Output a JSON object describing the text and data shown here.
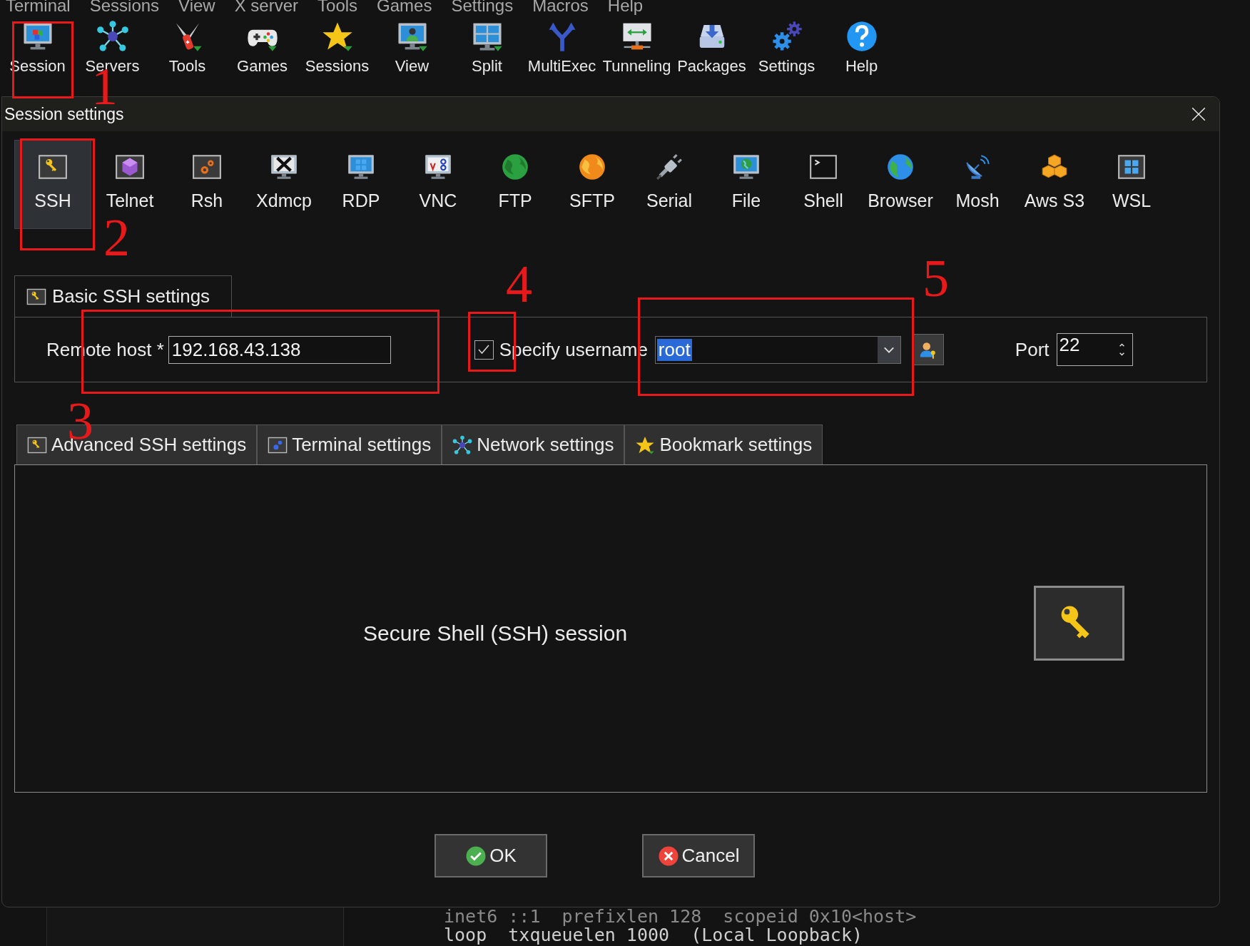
{
  "menu": [
    "Terminal",
    "Sessions",
    "View",
    "X server",
    "Tools",
    "Games",
    "Settings",
    "Macros",
    "Help"
  ],
  "toolbar": [
    {
      "label": "Session",
      "callout": "1"
    },
    {
      "label": "Servers"
    },
    {
      "label": "Tools"
    },
    {
      "label": "Games"
    },
    {
      "label": "Sessions"
    },
    {
      "label": "View"
    },
    {
      "label": "Split"
    },
    {
      "label": "MultiExec"
    },
    {
      "label": "Tunneling"
    },
    {
      "label": "Packages"
    },
    {
      "label": "Settings"
    },
    {
      "label": "Help"
    }
  ],
  "dialog": {
    "title": "Session settings",
    "session_types": [
      {
        "label": "SSH",
        "selected": true,
        "callout": "2"
      },
      {
        "label": "Telnet",
        "selected": false
      },
      {
        "label": "Rsh",
        "selected": false
      },
      {
        "label": "Xdmcp",
        "selected": false
      },
      {
        "label": "RDP",
        "selected": false
      },
      {
        "label": "VNC",
        "selected": false
      },
      {
        "label": "FTP",
        "selected": false
      },
      {
        "label": "SFTP",
        "selected": false
      },
      {
        "label": "Serial",
        "selected": false
      },
      {
        "label": "File",
        "selected": false
      },
      {
        "label": "Shell",
        "selected": false
      },
      {
        "label": "Browser",
        "selected": false
      },
      {
        "label": "Mosh",
        "selected": false
      },
      {
        "label": "Aws S3",
        "selected": false
      },
      {
        "label": "WSL",
        "selected": false
      }
    ],
    "basic_tab": {
      "label": "Basic SSH settings",
      "selected": true
    },
    "remote_host": {
      "label": "Remote host *",
      "value": "192.168.43.138",
      "callout": "3"
    },
    "specify_username": {
      "label": "Specify username",
      "checked": true,
      "callout": "4"
    },
    "username": {
      "value": "root",
      "text_selected": true,
      "callout": "5"
    },
    "port": {
      "label": "Port",
      "value": "22"
    },
    "tabs": [
      {
        "label": "Advanced SSH settings",
        "selected": false
      },
      {
        "label": "Terminal settings",
        "selected": false
      },
      {
        "label": "Network settings",
        "selected": false
      },
      {
        "label": "Bookmark settings",
        "selected": false
      }
    ],
    "description": "Secure Shell (SSH) session",
    "buttons": [
      {
        "label": "OK",
        "kind": "ok"
      },
      {
        "label": "Cancel",
        "kind": "cancel"
      }
    ]
  },
  "terminal_lines": [
    "inet6 ::1  prefixlen 128  scopeid 0x10<host>",
    "loop  txqueuelen 1000  (Local Loopback)"
  ]
}
